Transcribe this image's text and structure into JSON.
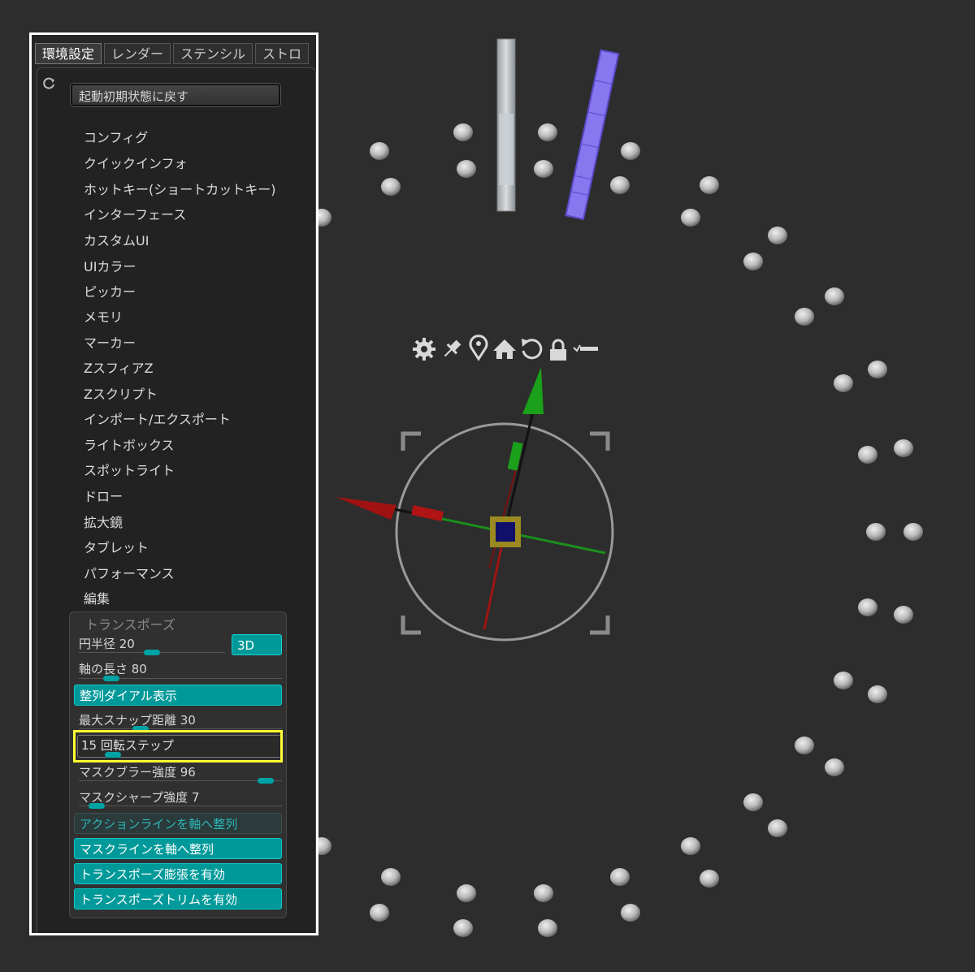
{
  "tabs": [
    {
      "label": "環境設定",
      "active": true
    },
    {
      "label": "レンダー",
      "active": false
    },
    {
      "label": "ステンシル",
      "active": false
    },
    {
      "label": "ストロ",
      "active": false
    }
  ],
  "reset_button": "起動初期状態に戻す",
  "menu_items": [
    "コンフィグ",
    "クイックインフォ",
    "ホットキー(ショートカットキー)",
    "インターフェース",
    "カスタムUI",
    "UIカラー",
    "ピッカー",
    "メモリ",
    "マーカー",
    "ZスフィアZ",
    "Zスクリプト",
    "インポート/エクスポート",
    "ライトボックス",
    "スポットライト",
    "ドロー",
    "拡大鏡",
    "タブレット",
    "パフォーマンス",
    "編集"
  ],
  "transpose": {
    "title": "トランスポーズ",
    "circle_radius": {
      "label": "円半径 20",
      "value": 20
    },
    "button_3d": "3D",
    "axis_length": {
      "label": "軸の長さ 80",
      "value": 80
    },
    "align_dial": "整列ダイアル表示",
    "max_snap": {
      "label": "最大スナップ距離 30",
      "value": 30
    },
    "rotation_step": {
      "label": "15  回転ステップ",
      "value": 15
    },
    "mask_blur": {
      "label": "マスクブラー強度 96",
      "value": 96
    },
    "mask_sharp": {
      "label": "マスクシャープ強度 7",
      "value": 7
    },
    "action_line_align": "アクションラインを軸へ整列",
    "mask_line_align": "マスクラインを軸へ整列",
    "transpose_inflate": "トランスポーズ膨張を有効",
    "transpose_trim": "トランスポーズトリムを有効"
  },
  "gizmo_icons": [
    "gear-icon",
    "pin-icon",
    "location-icon",
    "home-icon",
    "reset-icon",
    "lock-icon",
    "minus-icon"
  ],
  "colors": {
    "accent": "#009999",
    "highlight": "#ffff33",
    "x_axis": "#b01010",
    "y_axis": "#1aa01a"
  }
}
